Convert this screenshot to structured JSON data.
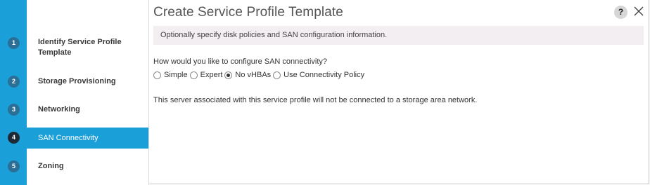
{
  "wizard": {
    "steps": [
      {
        "number": "1",
        "label": "Identify Service Profile Template"
      },
      {
        "number": "2",
        "label": "Storage Provisioning"
      },
      {
        "number": "3",
        "label": "Networking"
      },
      {
        "number": "4",
        "label": "SAN Connectivity"
      },
      {
        "number": "5",
        "label": "Zoning"
      }
    ],
    "active_step": "SAN Connectivity"
  },
  "header": {
    "title": "Create Service Profile Template",
    "help_icon": "?",
    "close_icon": "close-icon"
  },
  "main": {
    "info": "Optionally specify disk policies and SAN configuration information.",
    "question": "How would you like to configure SAN connectivity?",
    "options": [
      {
        "label": "Simple",
        "checked": false
      },
      {
        "label": "Expert",
        "checked": false
      },
      {
        "label": "No vHBAs",
        "checked": true
      },
      {
        "label": "Use Connectivity Policy",
        "checked": false
      }
    ],
    "message": "This server associated with this service profile will not be connected to a storage area network."
  },
  "colors": {
    "accent": "#1b9fd8",
    "step_circle": "#2b6f97",
    "active_step_circle": "#1d2a35",
    "info_bar": "#f3eef1"
  }
}
